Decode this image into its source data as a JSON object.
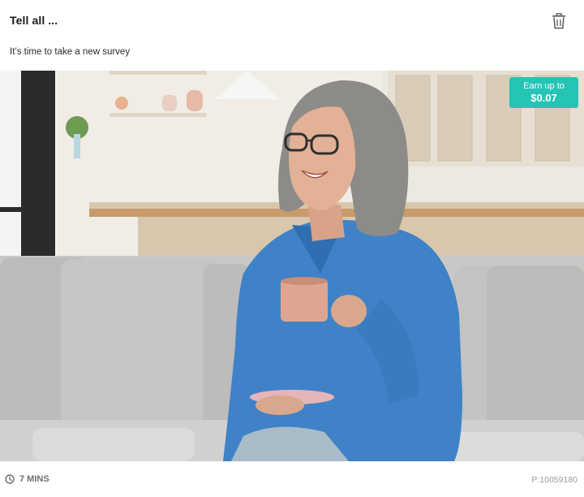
{
  "header": {
    "title": "Tell all ...",
    "subtitle": "It’s time to take a new survey",
    "delete_icon": "trash-icon"
  },
  "reward": {
    "label": "Earn up to",
    "value": "$0.07",
    "color": "#26c3b7"
  },
  "hero_image": {
    "subject": "woman-with-coffee-cup-on-sofa"
  },
  "footer": {
    "duration_icon": "clock-icon",
    "duration": "7 MINS",
    "project_id": "P:10059180"
  }
}
